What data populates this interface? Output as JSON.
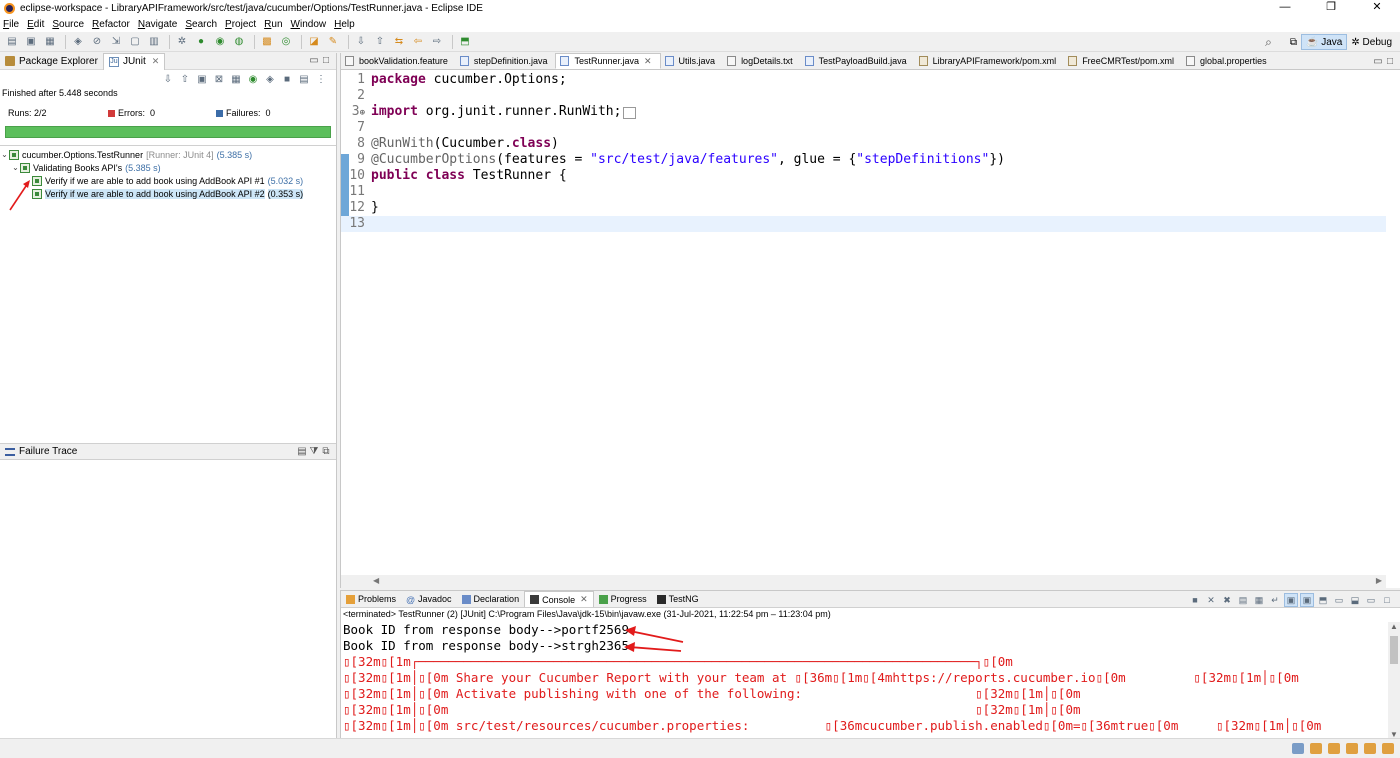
{
  "window": {
    "title": "eclipse-workspace - LibraryAPIFramework/src/test/java/cucumber/Options/TestRunner.java - Eclipse IDE",
    "controls": [
      "—",
      "❐",
      "✕"
    ]
  },
  "menu": [
    "File",
    "Edit",
    "Source",
    "Refactor",
    "Navigate",
    "Search",
    "Project",
    "Run",
    "Window",
    "Help"
  ],
  "perspectives": {
    "java": "Java",
    "debug": "Debug"
  },
  "left_view": {
    "tabs": [
      "Package Explorer",
      "JUnit"
    ],
    "finished": "Finished after 5.448 seconds",
    "runs_label": "Runs:",
    "runs_value": "2/2",
    "errors_label": "Errors:",
    "errors_value": "0",
    "failures_label": "Failures:",
    "failures_value": "0",
    "progress": 1.0,
    "tree": {
      "root_label": "cucumber.Options.TestRunner",
      "root_runner": "[Runner: JUnit 4]",
      "root_time": "(5.385 s)",
      "feature_label": "Validating Books API's",
      "feature_time": "(5.385 s)",
      "tests": [
        {
          "label": "Verify if we are able to add book using AddBook API #1",
          "time": "(5.032 s)"
        },
        {
          "label": "Verify if we are able to add book using AddBook API #2",
          "time": "(0.353 s)"
        }
      ]
    },
    "failure_trace": "Failure Trace"
  },
  "editor": {
    "tabs": [
      "bookValidation.feature",
      "stepDefinition.java",
      "TestRunner.java",
      "Utils.java",
      "logDetails.txt",
      "TestPayloadBuild.java",
      "LibraryAPIFramework/pom.xml",
      "FreeCMRTest/pom.xml",
      "global.properties"
    ],
    "active_tab": 2,
    "lines": {
      "l1": {
        "n": "1",
        "kw": "package",
        "rest": " cucumber.Options;"
      },
      "l2": {
        "n": "2"
      },
      "l3": {
        "n": "3",
        "kw": "import",
        "rest": " org.junit.runner.RunWith;"
      },
      "l7": {
        "n": "7"
      },
      "l8": {
        "n": "8",
        "ann": "@RunWith",
        "p1": "(Cucumber.",
        "kw": "class",
        "p2": ")"
      },
      "l9": {
        "n": "9",
        "ann": "@CucumberOptions",
        "p1": "(features = ",
        "s1": "\"src/test/java/features\"",
        "p2": ", glue = {",
        "s2": "\"stepDefinitions\"",
        "p3": "})"
      },
      "l10": {
        "n": "10",
        "kw1": "public",
        "kw2": "class",
        "rest": " TestRunner {"
      },
      "l11": {
        "n": "11"
      },
      "l12": {
        "n": "12",
        "rest": "}"
      },
      "l13": {
        "n": "13"
      }
    }
  },
  "console": {
    "tabs": [
      "Problems",
      "Javadoc",
      "Declaration",
      "Console",
      "Progress",
      "TestNG"
    ],
    "terminated": "<terminated> TestRunner (2) [JUnit] C:\\Program Files\\Java\\jdk-15\\bin\\javaw.exe  (31-Jul-2021, 11:22:54 pm – 11:23:04 pm)",
    "output": [
      "Book ID from response body-->portf2569",
      "Book ID from response body-->strgh2365",
      "▯[32m▯[1m┌──────────────────────────────────────────────────────────────────────────┐▯[0m",
      "▯[32m▯[1m│▯[0m Share your Cucumber Report with your team at ▯[36m▯[1m▯[4mhttps://reports.cucumber.io▯[0m         ▯[32m▯[1m│▯[0m",
      "▯[32m▯[1m│▯[0m Activate publishing with one of the following:                       ▯[32m▯[1m│▯[0m",
      "▯[32m▯[1m│▯[0m                                                                      ▯[32m▯[1m│▯[0m",
      "▯[32m▯[1m│▯[0m src/test/resources/cucumber.properties:          ▯[36mcucumber.publish.enabled▯[0m=▯[36mtrue▯[0m     ▯[32m▯[1m│▯[0m"
    ]
  },
  "colors": {
    "success_bar": "#5cbf5c",
    "annotation_arrow": "#e21b1b",
    "console_error_text": "#e01b1b",
    "keyword": "#7f0055",
    "string": "#2a00ff"
  }
}
